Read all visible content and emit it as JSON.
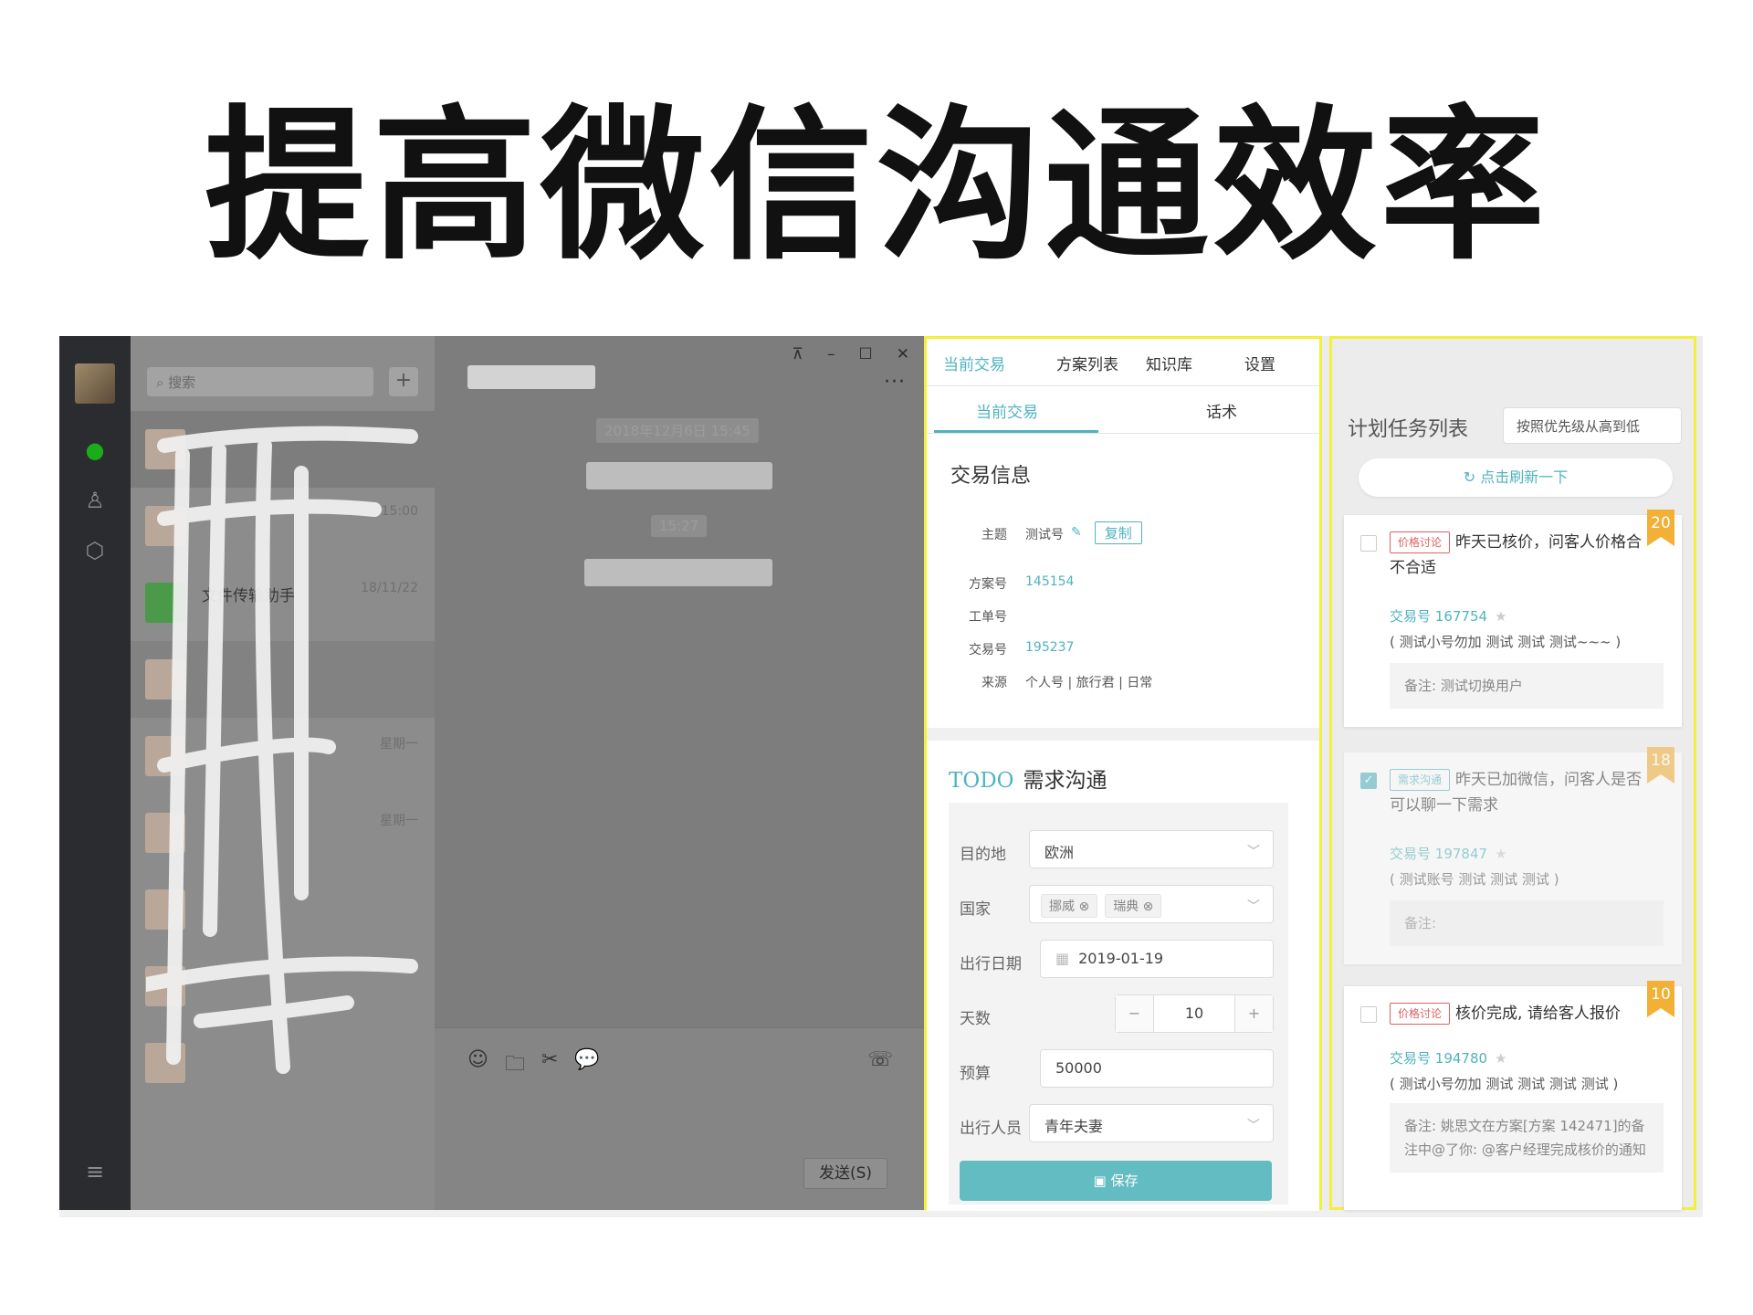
{
  "title": "提高微信沟通效率",
  "wechat": {
    "search_placeholder": "搜索",
    "plus": "+",
    "conversations": [
      {
        "name": "",
        "time": ""
      },
      {
        "name": "",
        "time": "15:00"
      },
      {
        "name": "文件传输助手",
        "time": "18/11/22"
      },
      {
        "name": "",
        "time": ""
      },
      {
        "name": "",
        "time": "星期一"
      },
      {
        "name": "",
        "time": "星期一"
      },
      {
        "name": "",
        "time": ""
      },
      {
        "name": "",
        "time": ""
      },
      {
        "name": "",
        "time": ""
      }
    ],
    "window_controls": {
      "pin": "⊼",
      "min": "–",
      "max": "☐",
      "close": "✕"
    },
    "more": "···",
    "chips": {
      "date": "2018年12月6日 15:45",
      "time": "15:27"
    },
    "send_label": "发送(S)"
  },
  "trade": {
    "tabs": [
      "当前交易",
      "方案列表",
      "知识库",
      "设置"
    ],
    "subtabs": [
      "当前交易",
      "话术"
    ],
    "info_title": "交易信息",
    "fields": [
      {
        "k": "主题",
        "v": "测试号"
      },
      {
        "k": "方案号",
        "v": "145154"
      },
      {
        "k": "工单号",
        "v": ""
      },
      {
        "k": "交易号",
        "v": "195237"
      },
      {
        "k": "来源",
        "v": "个人号 | 旅行君 | 日常"
      }
    ],
    "copy_label": "复制",
    "todo_prefix": "TODO",
    "todo_title": "需求沟通",
    "form": {
      "dest_label": "目的地",
      "dest_value": "欧洲",
      "country_label": "国家",
      "countries": [
        "挪威",
        "瑞典"
      ],
      "date_label": "出行日期",
      "date_value": "2019-01-19",
      "days_label": "天数",
      "days_value": "10",
      "budget_label": "预算",
      "budget_value": "50000",
      "people_label": "出行人员",
      "people_value": "青年夫妻"
    },
    "save_label": "保存"
  },
  "plan": {
    "title": "计划任务列表",
    "sort_value": "按照优先级从高到低",
    "refresh_label": "点击刷新一下",
    "tasks": [
      {
        "badge": "20",
        "tag": "价格讨论",
        "title": "昨天已核价，问客人价格合不合适",
        "tx_label": "交易号",
        "tx": "167754",
        "desc": "( 测试小号勿加 测试 测试 测试~~~ )",
        "note": "备注: 测试切换用户"
      },
      {
        "badge": "18",
        "tag": "需求沟通",
        "title": "昨天已加微信，问客人是否可以聊一下需求",
        "tx_label": "交易号",
        "tx": "197847",
        "desc": "( 测试账号 测试 测试 测试 )",
        "note": "备注:"
      },
      {
        "badge": "10",
        "tag": "价格讨论",
        "title": "核价完成, 请给客人报价",
        "tx_label": "交易号",
        "tx": "194780",
        "desc": "( 测试小号勿加 测试 测试 测试 测试 )",
        "note": "备注: 姚思文在方案[方案 142471]的备注中@了你: @客户经理完成核价的通知"
      }
    ]
  },
  "colors": {
    "accent": "#4fb3bf",
    "highlight": "#f4ee3c",
    "badge": "#f2b036",
    "tag_red": "#e06060"
  }
}
